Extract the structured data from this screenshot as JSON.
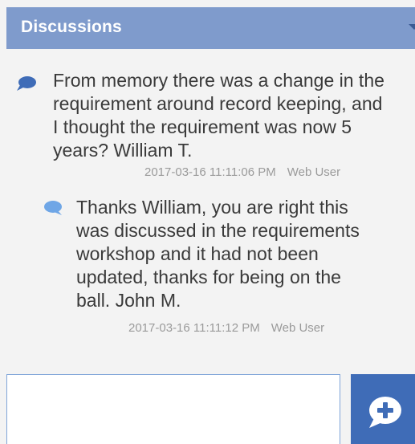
{
  "header": {
    "title": "Discussions",
    "collapse_icon": "chevron-down-icon"
  },
  "messages": [
    {
      "icon": "speech-bubble-icon",
      "text": "From memory there was a change in the\nrequirement around record keeping, and\nI thought the requirement was now 5\nyears? William T.",
      "timestamp": "2017-03-16 11:11:06 PM",
      "source": "Web User"
    },
    {
      "icon": "speech-bubble-icon",
      "text": "Thanks William, you are right this\nwas discussed in the requirements\nworkshop and it had not been\nupdated, thanks for being on the\nball. John M.",
      "timestamp": "2017-03-16 11:11:12 PM",
      "source": "Web User"
    }
  ],
  "compose": {
    "value": "",
    "send_icon": "add-comment-icon"
  },
  "colors": {
    "header_bg": "#7f9bcc",
    "accent": "#3f6cb7",
    "reply_icon": "#6fa6e6"
  }
}
